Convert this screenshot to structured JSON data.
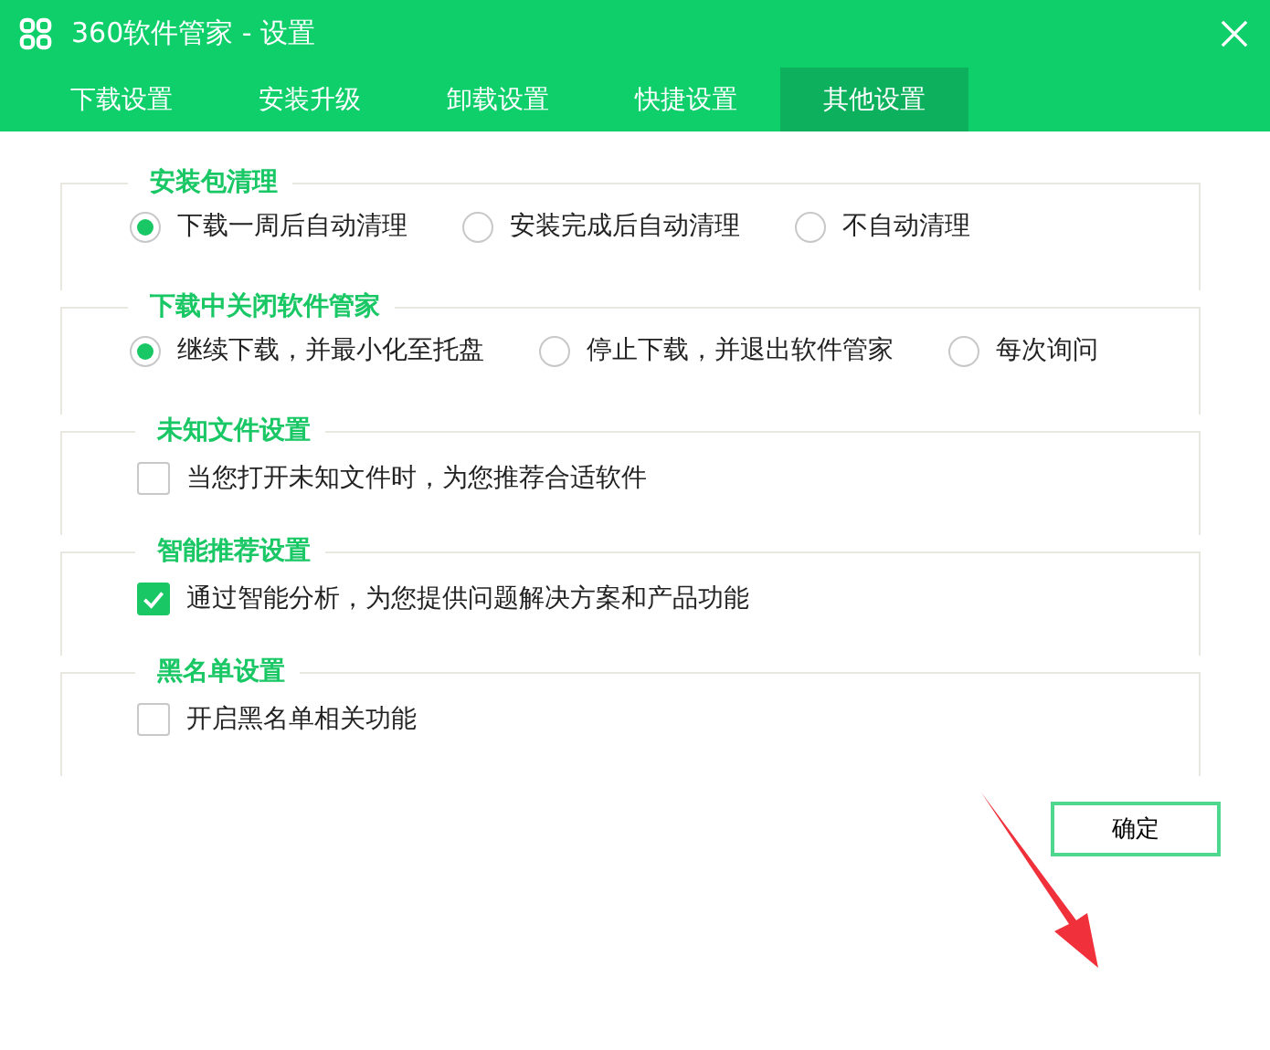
{
  "window": {
    "title": "360软件管家 - 设置"
  },
  "tabs": [
    {
      "label": "下载设置",
      "selected": false
    },
    {
      "label": "安装升级",
      "selected": false
    },
    {
      "label": "卸载设置",
      "selected": false
    },
    {
      "label": "快捷设置",
      "selected": false
    },
    {
      "label": "其他设置",
      "selected": true
    }
  ],
  "sections": [
    {
      "title": "安装包清理",
      "kind": "radio",
      "options": [
        {
          "label": "下载一周后自动清理",
          "selected": true
        },
        {
          "label": "安装完成后自动清理",
          "selected": false
        },
        {
          "label": "不自动清理",
          "selected": false
        }
      ]
    },
    {
      "title": "下载中关闭软件管家",
      "kind": "radio",
      "options": [
        {
          "label": "继续下载，并最小化至托盘",
          "selected": true
        },
        {
          "label": "停止下载，并退出软件管家",
          "selected": false
        },
        {
          "label": "每次询问",
          "selected": false
        }
      ]
    },
    {
      "title": "未知文件设置",
      "kind": "checkbox",
      "options": [
        {
          "label": "当您打开未知文件时，为您推荐合适软件",
          "checked": false
        }
      ]
    },
    {
      "title": "智能推荐设置",
      "kind": "checkbox",
      "options": [
        {
          "label": "通过智能分析，为您提供问题解决方案和产品功能",
          "checked": true
        }
      ]
    },
    {
      "title": "黑名单设置",
      "kind": "checkbox",
      "options": [
        {
          "label": "开启黑名单相关功能",
          "checked": false
        }
      ]
    }
  ],
  "buttons": [
    "确定"
  ],
  "annotation": {
    "kind": "arrow"
  }
}
